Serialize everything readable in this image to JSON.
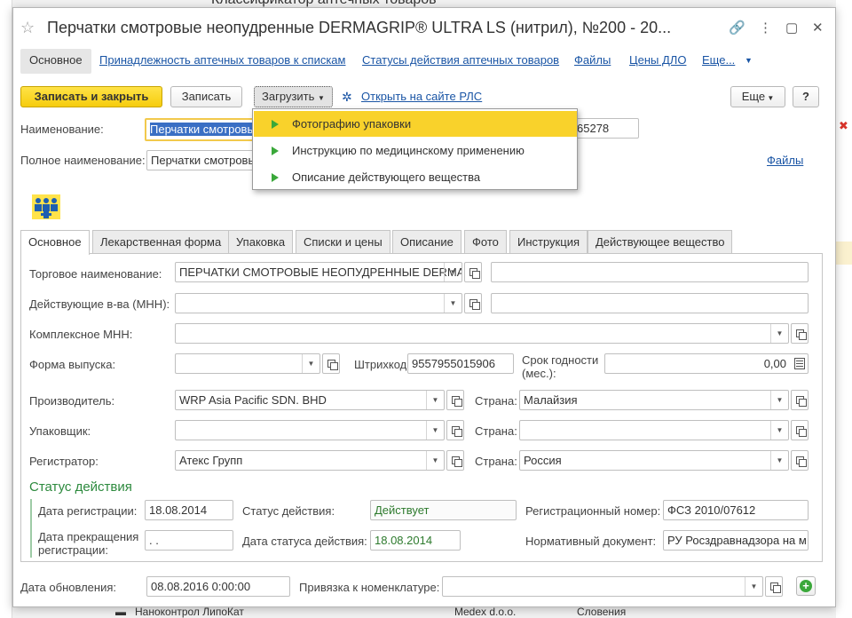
{
  "background": {
    "title": "Классификатор аптечных товаров",
    "rows": [
      "Наноконтрол ЛипоКат",
      "Medex d.o.o.",
      "Словения"
    ]
  },
  "window": {
    "title": "Перчатки смотровые неопудренные DERMAGRIP® ULTRA LS (нитрил), №200 - 20...",
    "controls": {
      "link": "🔗",
      "menu": "⋮",
      "min": "▢",
      "close": "✕"
    }
  },
  "nav": {
    "items": [
      "Основное",
      "Принадлежность аптечных товаров к спискам",
      "Статусы действия аптечных товаров",
      "Файлы",
      "Цены ДЛО",
      "Еще..."
    ]
  },
  "toolbar": {
    "save_close": "Записать и закрыть",
    "save": "Записать",
    "load": "Загрузить",
    "open_rls": "Открыть на сайте РЛС",
    "more": "Еще",
    "help": "?"
  },
  "load_menu": {
    "items": [
      "Фотографию упаковки",
      "Инструкцию по медицинскому применению",
      "Описание действующего вещества"
    ]
  },
  "header_fields": {
    "name_label": "Наименование:",
    "name_value": "Перчатки смотровые неопудр...",
    "code_value": "65278",
    "fullname_label": "Полное наименование:",
    "fullname_value": "Перчатки смотровые неопудр...",
    "files_link": "Файлы"
  },
  "tabs": [
    "Основное",
    "Лекарственная форма",
    "Упаковка",
    "Списки и цены",
    "Описание",
    "Фото",
    "Инструкция",
    "Действующее вещество"
  ],
  "form": {
    "trade_name_label": "Торговое наименование:",
    "trade_name_value": "ПЕРЧАТКИ СМОТРОВЫЕ НЕОПУДРЕННЫЕ DERMAGRIP",
    "inn_label": "Действующие в-ва (МНН):",
    "inn_value": "",
    "complex_inn_label": "Комплексное МНН:",
    "complex_inn_value": "",
    "form_label": "Форма выпуска:",
    "form_value": "",
    "barcode_label": "Штрихкод:",
    "barcode_value": "9557955015906",
    "shelf_label_1": "Срок годности",
    "shelf_label_2": "(мес.):",
    "shelf_value": "0,00",
    "maker_label": "Производитель:",
    "maker_value": "WRP Asia Pacific SDN. BHD",
    "country_label": "Страна:",
    "maker_country": "Малайзия",
    "packer_label": "Упаковщик:",
    "packer_value": "",
    "packer_country": "",
    "registrar_label": "Регистратор:",
    "registrar_value": "Атекс Групп",
    "registrar_country": "Россия"
  },
  "status": {
    "title": "Статус действия",
    "reg_date_label": "Дата регистрации:",
    "reg_date_value": "18.08.2014",
    "status_label": "Статус действия:",
    "status_value": "Действует",
    "reg_number_label": "Регистрационный номер:",
    "reg_number_value": "ФСЗ 2010/07612",
    "end_label_1": "Дата прекращения",
    "end_label_2": "регистрации:",
    "end_value": " .  .",
    "status_date_label": "Дата статуса действия:",
    "status_date_value": "18.08.2014",
    "norm_doc_label": "Нормативный документ:",
    "norm_doc_value": "РУ Росздравнадзора на м"
  },
  "footer": {
    "update_label": "Дата обновления:",
    "update_value": "08.08.2016  0:00:00",
    "binding_label": "Привязка к номенклатуре:",
    "binding_value": ""
  },
  "colors": {
    "accent_yellow": "#f9d22b",
    "link_blue": "#1a55a5",
    "status_green": "#2d8a3e"
  }
}
